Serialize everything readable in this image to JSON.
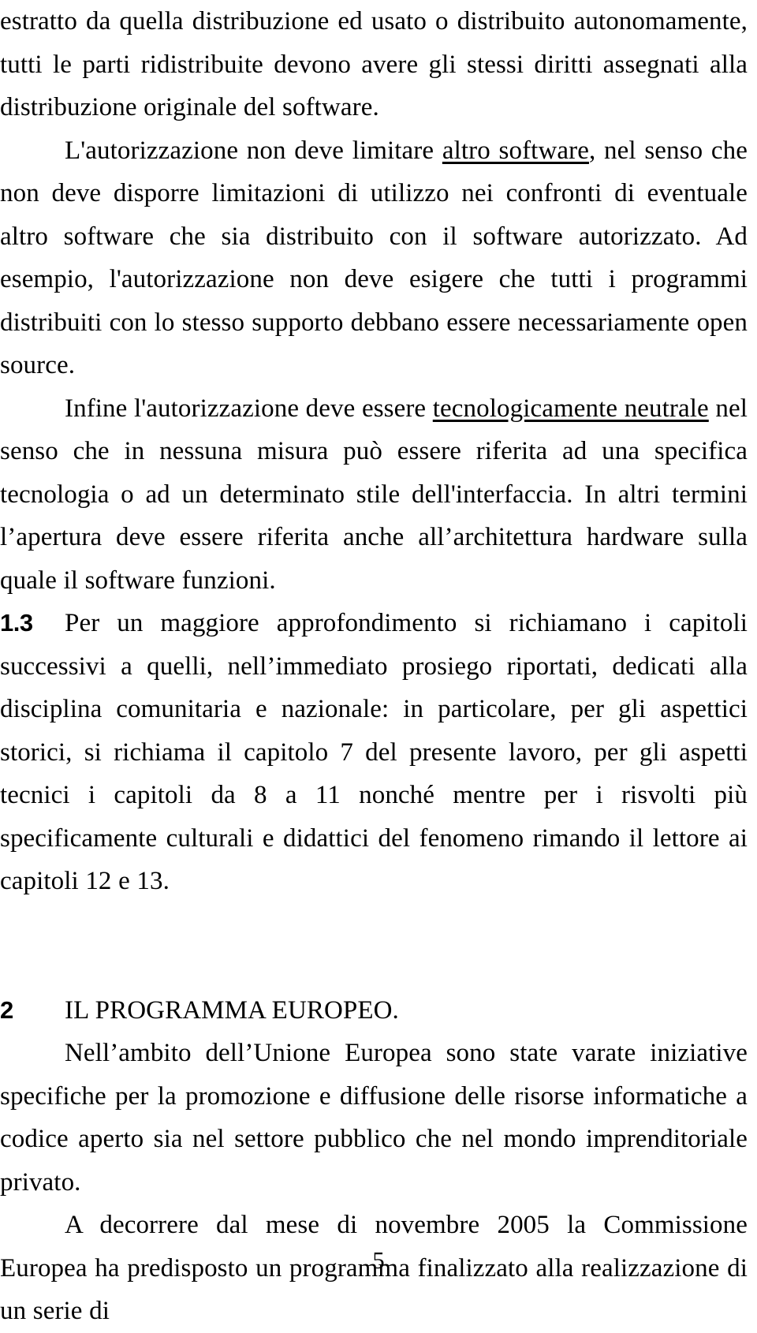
{
  "document": {
    "language": "it",
    "page_number": "5",
    "paragraphs": [
      {
        "id": "p1",
        "type": "continuation",
        "text": "estratto da quella distribuzione ed usato o distribuito autonomamente, tutti le parti ridistribuite devono avere gli stessi diritti assegnati alla distribuzione originale del software."
      },
      {
        "id": "p2",
        "type": "indented",
        "segments": [
          {
            "text": "L'autorizzazione non deve limitare ",
            "style": "normal"
          },
          {
            "text": "altro software",
            "style": "underline"
          },
          {
            "text": ", nel senso che non deve disporre limitazioni di utilizzo nei confronti di eventuale altro software che sia distribuito con il software autorizzato. Ad esempio, l'autorizzazione non deve esigere che tutti i programmi distribuiti con lo stesso supporto debbano essere necessariamente open source.",
            "style": "normal"
          }
        ]
      },
      {
        "id": "p3",
        "type": "indented",
        "segments": [
          {
            "text": "Infine l'autorizzazione deve essere ",
            "style": "normal"
          },
          {
            "text": "tecnologicamente neutrale",
            "style": "underline"
          },
          {
            "text": " nel senso che in nessuna misura può essere riferita ad una specifica tecnologia o ad un determinato stile dell'interfaccia. In altri termini l’apertura deve essere riferita anche all’architettura hardware sulla quale il software funzioni.",
            "style": "normal"
          }
        ]
      },
      {
        "id": "p4",
        "type": "numbered",
        "number": "1.3",
        "text": "Per un maggiore approfondimento si richiamano i capitoli successivi a quelli, nell’immediato prosiego riportati, dedicati alla disciplina comunitaria e nazionale: in particolare, per gli aspettici storici, si richiama il capitolo 7 del presente lavoro, per gli aspetti tecnici i capitoli da 8 a 11 nonché mentre per i risvolti più specificamente culturali e didattici del fenomeno rimando il lettore ai capitoli 12 e 13."
      }
    ],
    "section_heading": {
      "number": "2",
      "title": "IL PROGRAMMA EUROPEO."
    },
    "paragraphs_after_heading": [
      {
        "id": "p5",
        "type": "indented",
        "text": "Nell’ambito dell’Unione Europea sono state varate iniziative specifiche per la promozione e diffusione delle risorse informatiche a codice aperto sia nel settore pubblico che nel mondo imprenditoriale privato."
      },
      {
        "id": "p6",
        "type": "indented",
        "text": "A decorrere dal mese di novembre 2005 la Commissione Europea ha predisposto un programma finalizzato alla realizzazione di un serie di"
      }
    ]
  }
}
